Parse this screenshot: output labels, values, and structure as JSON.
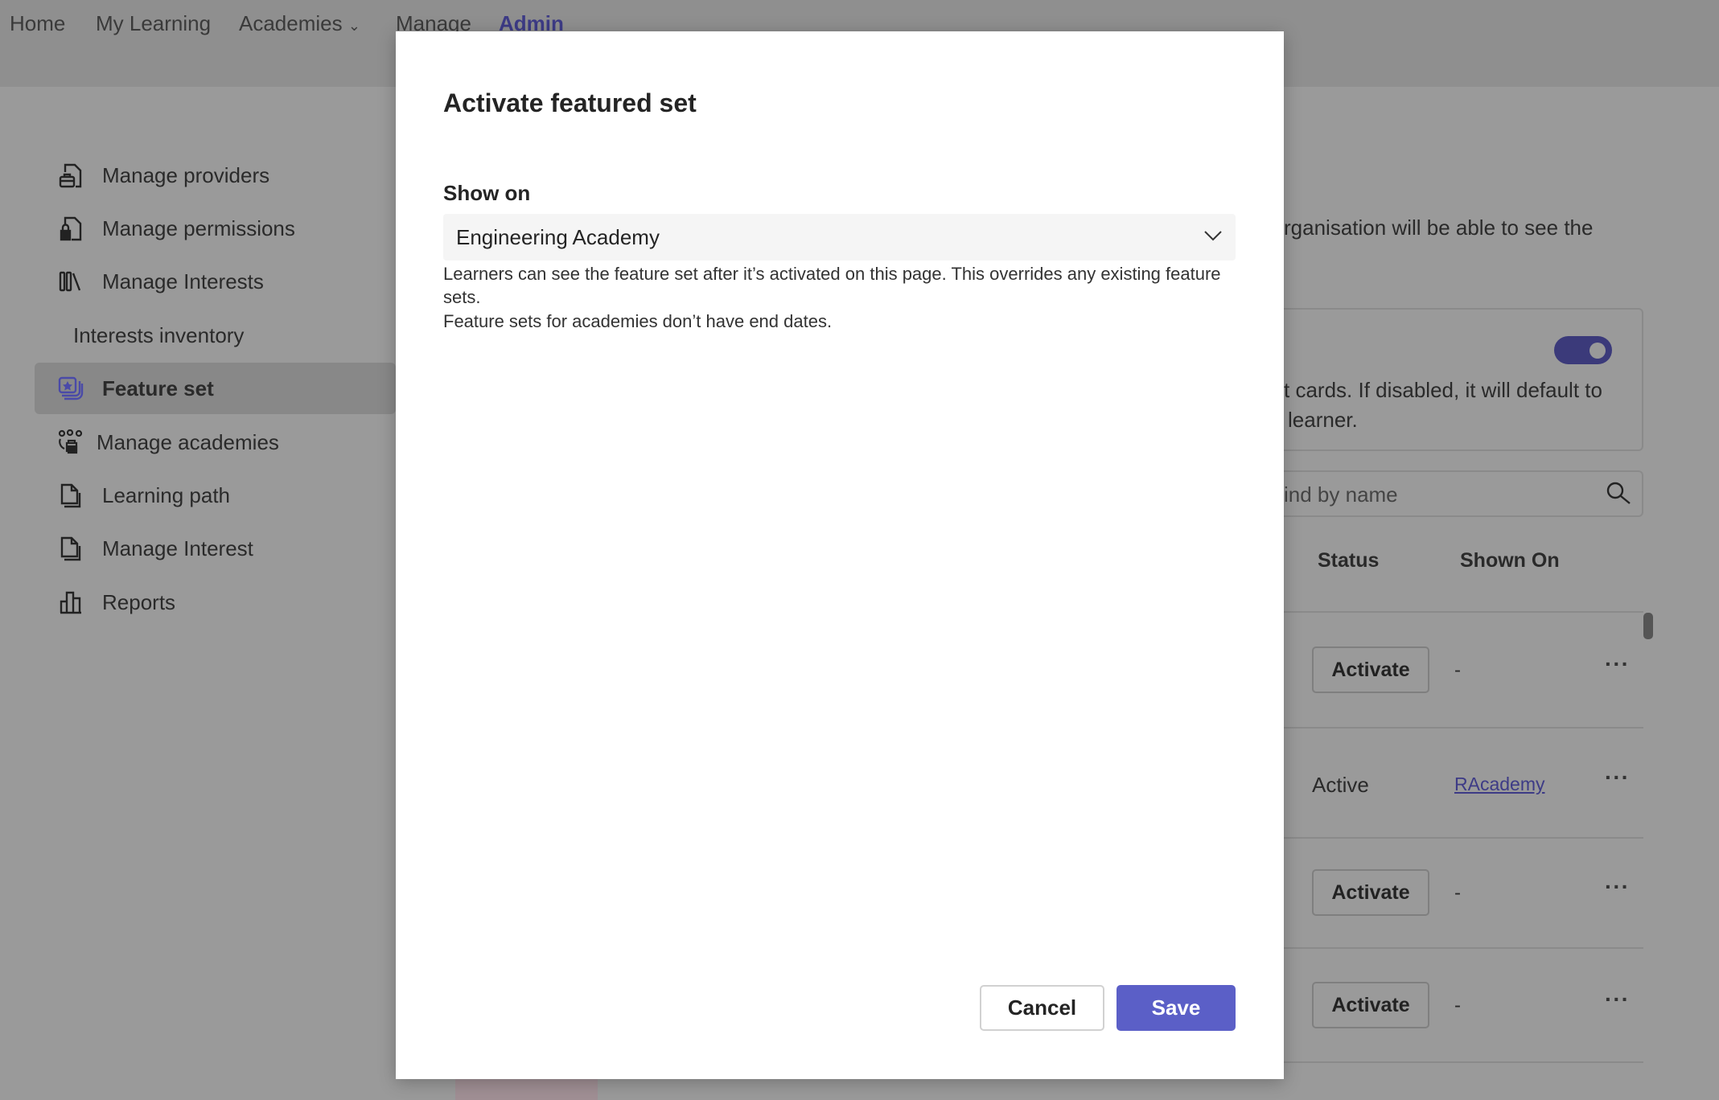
{
  "nav": {
    "items": [
      {
        "label": "Home"
      },
      {
        "label": "My Learning"
      },
      {
        "label": "Academies"
      },
      {
        "label": "Manage"
      },
      {
        "label": "Admin"
      }
    ]
  },
  "sidebar": {
    "items": [
      {
        "label": "Manage providers",
        "icon": "provider-icon"
      },
      {
        "label": "Manage permissions",
        "icon": "lock-document-icon"
      },
      {
        "label": "Manage Interests",
        "icon": "library-icon"
      },
      {
        "label": "Interests inventory"
      },
      {
        "label": "Feature set",
        "icon": "star-stack-icon",
        "selected": true
      },
      {
        "label": "Manage academies",
        "icon": "people-group-icon"
      },
      {
        "label": "Learning path",
        "icon": "document-icon"
      },
      {
        "label": "Manage Interest",
        "icon": "document-icon"
      },
      {
        "label": "Reports",
        "icon": "bar-chart-icon"
      }
    ]
  },
  "background": {
    "description_fragment": "rganisation will be able to see the",
    "card_text_line1": "t cards. If disabled, it will default to",
    "card_text_line2": "learner.",
    "toggle_on": true,
    "search_placeholder": "ind by name",
    "table": {
      "headers": [
        "Status",
        "Shown On"
      ],
      "rows": [
        {
          "status": "Activate",
          "shown_on": "-"
        },
        {
          "status": "Active",
          "shown_on": "RAcademy"
        },
        {
          "status": "Activate",
          "shown_on": "-"
        },
        {
          "status": "Activate",
          "shown_on": "-"
        }
      ]
    },
    "more_label": "···"
  },
  "modal": {
    "title": "Activate featured set",
    "field_label": "Show on",
    "selected_value": "Engineering Academy",
    "help_line1": "Learners can see the feature set after it’s activated on this page. This overrides any existing feature sets.",
    "help_line2": "Feature sets for academies don’t have end dates.",
    "cancel_label": "Cancel",
    "save_label": "Save"
  },
  "colors": {
    "accent": "#5b5fc7",
    "toggle": "#3b3a7a",
    "link": "#3d3b86"
  }
}
